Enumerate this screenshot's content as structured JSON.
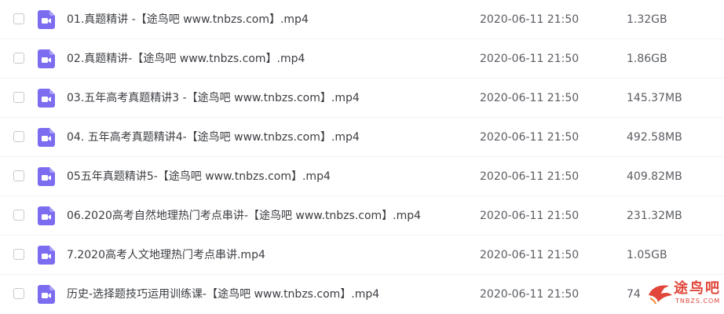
{
  "files": [
    {
      "name": "01.真题精讲 -【途鸟吧 www.tnbzs.com】.mp4",
      "date": "2020-06-11 21:50",
      "size": "1.32GB",
      "icon": "video-file-icon"
    },
    {
      "name": "02.真题精讲-【途鸟吧 www.tnbzs.com】.mp4",
      "date": "2020-06-11 21:50",
      "size": "1.86GB",
      "icon": "video-file-icon"
    },
    {
      "name": "03.五年高考真题精讲3 -【途鸟吧 www.tnbzs.com】.mp4",
      "date": "2020-06-11 21:50",
      "size": "145.37MB",
      "icon": "video-file-icon"
    },
    {
      "name": "04. 五年高考真题精讲4-【途鸟吧 www.tnbzs.com】.mp4",
      "date": "2020-06-11 21:50",
      "size": "492.58MB",
      "icon": "video-file-icon"
    },
    {
      "name": "05五年真题精讲5-【途鸟吧 www.tnbzs.com】.mp4",
      "date": "2020-06-11 21:50",
      "size": "409.82MB",
      "icon": "video-file-icon"
    },
    {
      "name": "06.2020高考自然地理热门考点串讲-【途鸟吧 www.tnbzs.com】.mp4",
      "date": "2020-06-11 21:50",
      "size": "231.32MB",
      "icon": "video-file-icon"
    },
    {
      "name": "7.2020高考人文地理热门考点串讲.mp4",
      "date": "2020-06-11 21:50",
      "size": "1.05GB",
      "icon": "video-file-icon"
    },
    {
      "name": "历史-选择题技巧运用训练课-【途鸟吧 www.tnbzs.com】.mp4",
      "date": "2020-06-11 21:50",
      "size": "74",
      "icon": "video-file-icon"
    }
  ],
  "watermark": {
    "text": "途鸟吧",
    "subtext": "TNBZS.COM"
  },
  "colors": {
    "icon_accent": "#7b6cf0",
    "watermark": "#e0463a",
    "divider": "#f1f2f4"
  }
}
